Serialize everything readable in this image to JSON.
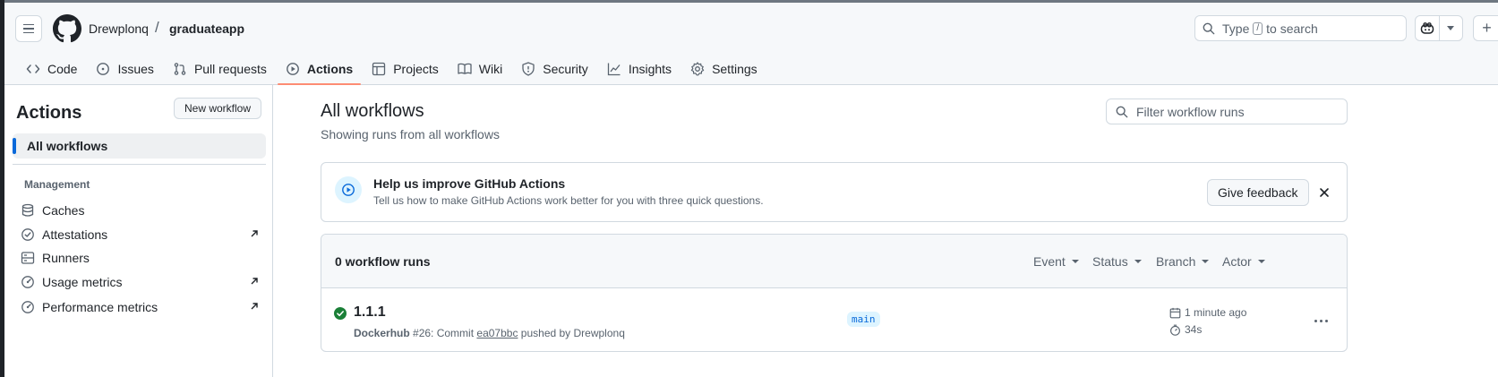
{
  "header": {
    "owner": "Drewplonq",
    "separator": "/",
    "repo": "graduateapp",
    "search_prefix": "Type",
    "search_key": "/",
    "search_suffix": "to search"
  },
  "tabs": [
    {
      "label": "Code",
      "icon": "code-icon"
    },
    {
      "label": "Issues",
      "icon": "issue-opened-icon"
    },
    {
      "label": "Pull requests",
      "icon": "git-pull-request-icon"
    },
    {
      "label": "Actions",
      "icon": "play-icon",
      "active": true
    },
    {
      "label": "Projects",
      "icon": "table-icon"
    },
    {
      "label": "Wiki",
      "icon": "book-icon"
    },
    {
      "label": "Security",
      "icon": "shield-icon"
    },
    {
      "label": "Insights",
      "icon": "graph-icon"
    },
    {
      "label": "Settings",
      "icon": "gear-icon"
    }
  ],
  "sidebar": {
    "title": "Actions",
    "new_workflow": "New workflow",
    "all_workflows": "All workflows",
    "management_label": "Management",
    "items": [
      {
        "label": "Caches",
        "icon": "database-icon",
        "external": false
      },
      {
        "label": "Attestations",
        "icon": "verified-icon",
        "external": true
      },
      {
        "label": "Runners",
        "icon": "server-icon",
        "external": false
      },
      {
        "label": "Usage metrics",
        "icon": "meter-icon",
        "external": true
      },
      {
        "label": "Performance metrics",
        "icon": "meter-icon",
        "external": true
      }
    ]
  },
  "main": {
    "title": "All workflows",
    "subtitle": "Showing runs from all workflows",
    "filter_placeholder": "Filter workflow runs",
    "banner": {
      "heading": "Help us improve GitHub Actions",
      "text": "Tell us how to make GitHub Actions work better for you with three quick questions.",
      "feedback_button": "Give feedback"
    },
    "runs": {
      "count_label": "0 workflow runs",
      "filters": [
        "Event",
        "Status",
        "Branch",
        "Actor"
      ],
      "items": [
        {
          "title": "1.1.1",
          "workflow": "Dockerhub",
          "run_number": "#26: Commit",
          "commit": "ea07bbc",
          "pushed_by": "pushed by Drewplonq",
          "branch": "main",
          "time_ago": "1 minute ago",
          "duration": "34s",
          "status": "success"
        }
      ]
    }
  },
  "colors": {
    "accent": "#0969da",
    "tab_underline": "#fd8c73",
    "success": "#1a7f37",
    "muted": "#59636e"
  }
}
